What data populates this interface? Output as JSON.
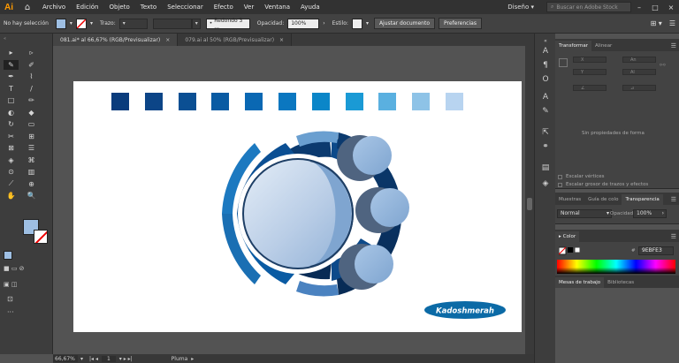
{
  "app": {
    "logo": "Ai"
  },
  "menu": [
    "Archivo",
    "Edición",
    "Objeto",
    "Texto",
    "Seleccionar",
    "Efecto",
    "Ver",
    "Ventana",
    "Ayuda"
  ],
  "workspace": "Diseño",
  "stock_search_placeholder": "Buscar en Adobe Stock",
  "control": {
    "selection": "No hay selección",
    "stroke_label": "Trazo:",
    "brush": "Redondo 3 ...",
    "opacity_label": "Opacidad:",
    "opacity": "100%",
    "style_label": "Estilo:",
    "fit_button": "Ajustar documento",
    "prefs_button": "Preferencias"
  },
  "tabs": [
    {
      "label": "081.ai* al 66,67% (RGB/Previsualizar)",
      "close": "×"
    },
    {
      "label": "079.ai al 50% (RGB/Previsualizar)",
      "close": "×"
    }
  ],
  "tools": [
    "▸",
    "▹",
    "✎",
    "✐",
    "✒",
    "⌇",
    "T",
    "/",
    "□",
    "✏",
    "◐",
    "◆",
    "↻",
    "▭",
    "✂",
    "⊞",
    "⊠",
    "☰",
    "◈",
    "⌘",
    "⊙",
    "▥",
    "⟋",
    "⊕",
    "✋",
    "🔍"
  ],
  "palette": [
    "#0a3c7c",
    "#0c4587",
    "#0b4f93",
    "#0a5ba3",
    "#0a68b3",
    "#0b77c0",
    "#0b86c8",
    "#1a9ad5",
    "#5ab0e0",
    "#8ec3e7",
    "#b8d4f0"
  ],
  "logo_text": "Kadoshmerah",
  "status": {
    "zoom": "66,67%",
    "page": "1",
    "tool": "Pluma"
  },
  "panels": {
    "transform": {
      "tabs": [
        "Transformar",
        "Alinear"
      ],
      "empty": "Sin propiedades de forma",
      "option1": "Escalar vértices",
      "option2": "Escalar grosor de trazos y efectos"
    },
    "transparency": {
      "tabs": [
        "Muestras",
        "Guía de colo",
        "Transparencia"
      ],
      "mode": "Normal",
      "opacity_label": "Opacidad:",
      "opacity": "100%"
    },
    "color": {
      "tab": "Color",
      "hex_label": "#",
      "hex": "9EBFE3"
    },
    "layers": {
      "tabs": [
        "Mesas de trabajo",
        "Bibliotecas"
      ]
    }
  },
  "colors": {
    "fill": "#9ebfe3"
  }
}
